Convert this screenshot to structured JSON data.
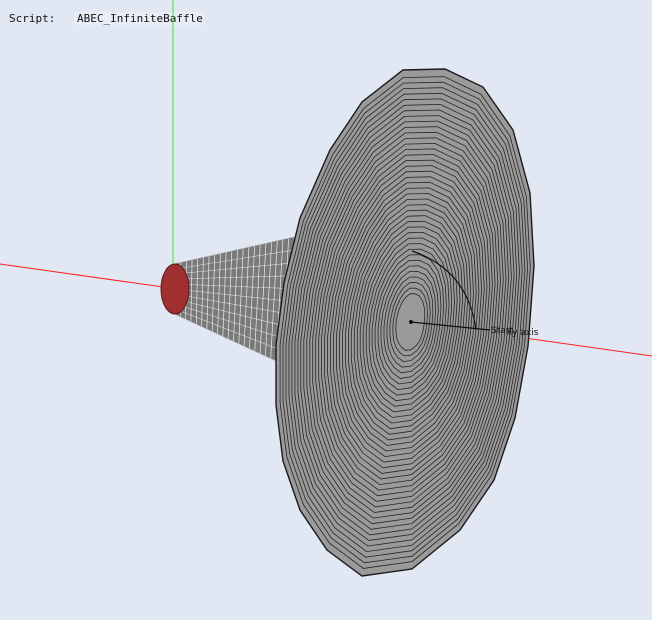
{
  "header": {
    "script_label": "Script:",
    "script_value": "ABEC_InfiniteBaffle"
  },
  "viewport": {
    "overlay_labels": [
      "Start",
      "Xy axis"
    ]
  },
  "colors": {
    "background": "#e1e8f3",
    "x_axis": "#ff2020",
    "y_axis": "#40e040",
    "horn_fill": "#9a9a9a",
    "horn_lines": "#1a1a1a",
    "throat": "#a03030",
    "mesh": "#ffffff"
  }
}
